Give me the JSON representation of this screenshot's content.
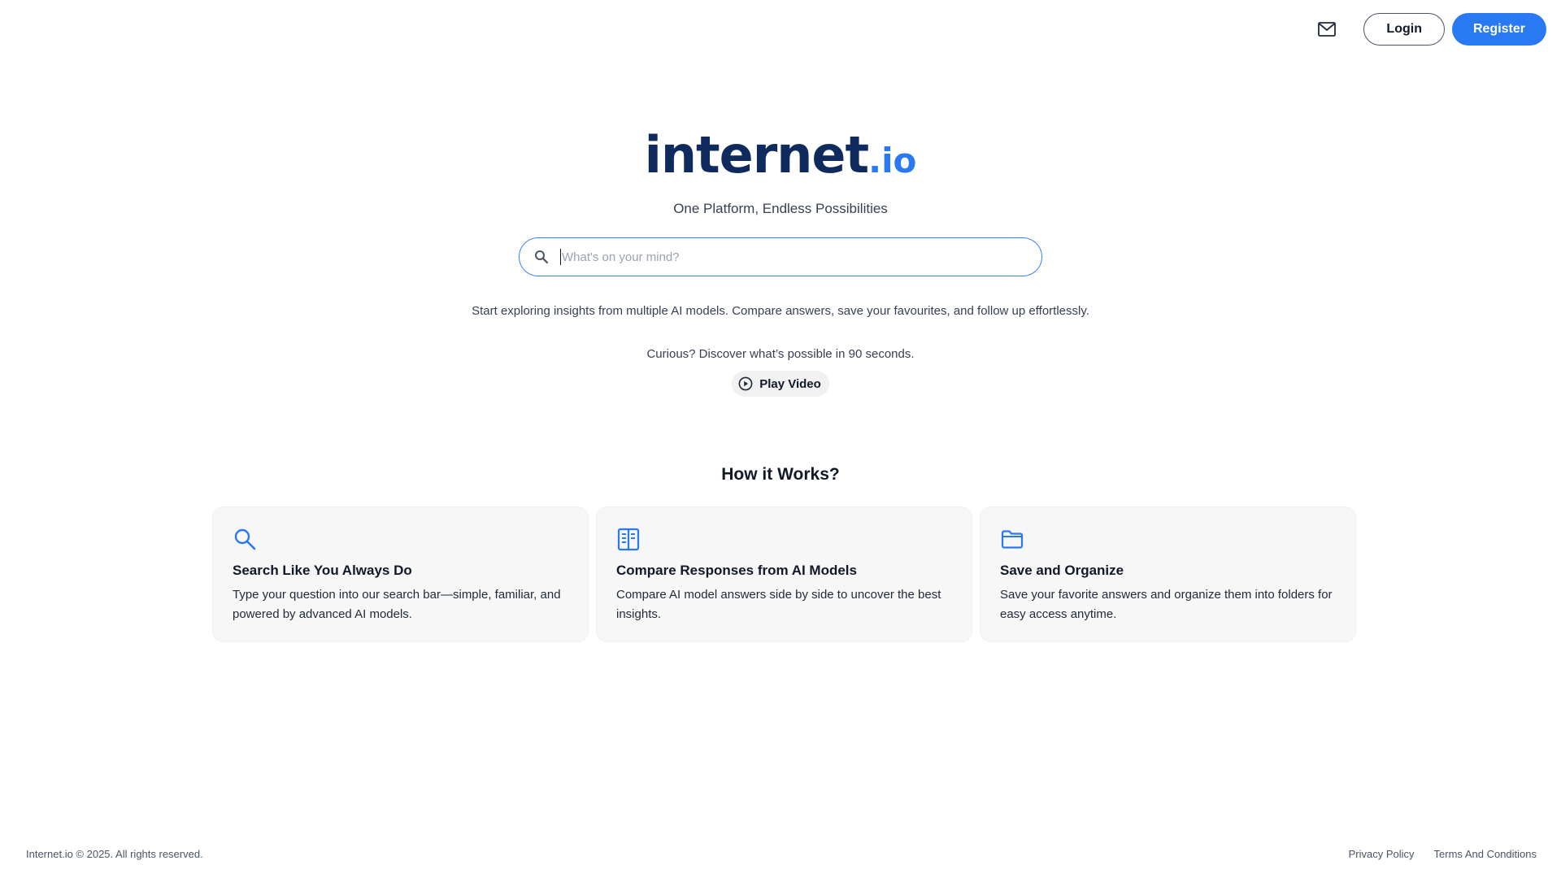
{
  "header": {
    "mail_icon": "mail-icon",
    "login_label": "Login",
    "register_label": "Register"
  },
  "hero": {
    "logo_main": "internet",
    "logo_tld": ".io",
    "tagline": "One Platform, Endless Possibilities",
    "search_placeholder": "What's on your mind?",
    "search_value": "",
    "intro": "Start exploring insights from multiple AI models. Compare answers, save your favourites, and follow up effortlessly.",
    "curious": "Curious? Discover what’s possible in 90 seconds.",
    "play_label": "Play Video"
  },
  "how": {
    "title": "How it Works?",
    "cards": [
      {
        "icon": "search-icon",
        "title": "Search Like You Always Do",
        "desc": "Type your question into our search bar—simple, familiar, and powered by advanced AI models."
      },
      {
        "icon": "compare-book-icon",
        "title": "Compare Responses from AI Models",
        "desc": "Compare AI model answers side by side to uncover the best insights."
      },
      {
        "icon": "folder-icon",
        "title": "Save and Organize",
        "desc": "Save your favorite answers and organize them into folders for easy access anytime."
      }
    ]
  },
  "footer": {
    "copyright": "Internet.io © 2025. All rights reserved.",
    "privacy": "Privacy Policy",
    "terms": "Terms And Conditions"
  },
  "colors": {
    "accent": "#2979f2",
    "logo_dark": "#0f2a5c",
    "card_bg": "#f7f7f7"
  }
}
